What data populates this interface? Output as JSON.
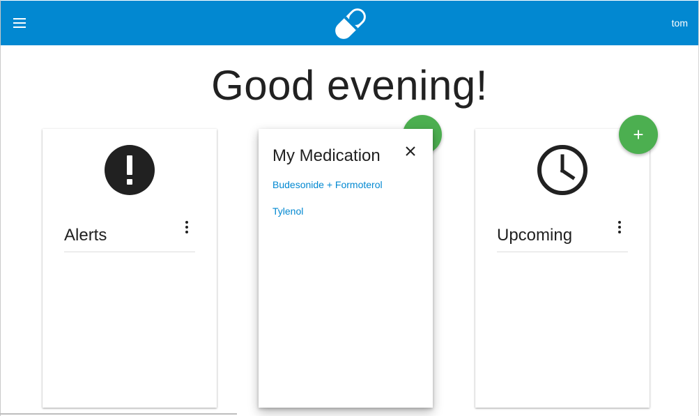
{
  "header": {
    "menu_icon": "menu-icon",
    "logo_icon": "pill-icon",
    "user_name": "tom",
    "background_color": "#0288d1"
  },
  "greeting": "Good evening!",
  "cards": {
    "alerts": {
      "title": "Alerts",
      "icon": "alert-circle-icon"
    },
    "medication": {
      "title": "My Medication",
      "close_icon": "close-icon",
      "items": [
        "Budesonide + Formoterol",
        "Tylenol"
      ]
    },
    "upcoming": {
      "title": "Upcoming",
      "icon": "clock-icon"
    }
  },
  "fab": {
    "icon": "plus-icon",
    "label": "+",
    "color": "#4caf50"
  },
  "link_color": "#0288d1"
}
